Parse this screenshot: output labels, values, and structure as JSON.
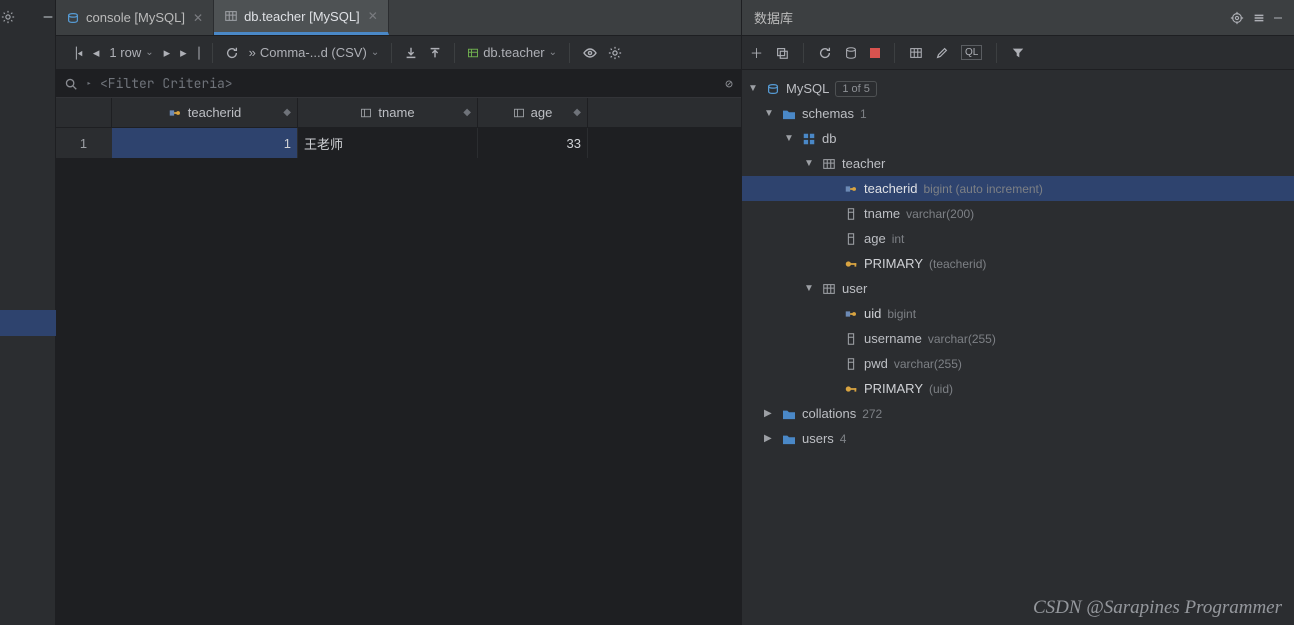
{
  "tabs": [
    {
      "label": "console [MySQL]",
      "active": false
    },
    {
      "label": "db.teacher [MySQL]",
      "active": true
    }
  ],
  "toolbar": {
    "rows_label": "1 row",
    "export_label": "Comma-...d (CSV)",
    "schema_label": "db.teacher"
  },
  "filter": {
    "placeholder": "<Filter Criteria>"
  },
  "grid": {
    "columns": [
      {
        "name": "teacherid",
        "kind": "pk"
      },
      {
        "name": "tname",
        "kind": "col"
      },
      {
        "name": "age",
        "kind": "col"
      }
    ],
    "rows": [
      {
        "num": "1",
        "teacherid": "1",
        "tname": "王老师",
        "age": "33"
      }
    ]
  },
  "right": {
    "title": "数据库",
    "tree": {
      "root": {
        "label": "MySQL",
        "badge": "1 of 5"
      },
      "schemas": {
        "label": "schemas",
        "count": "1"
      },
      "db": {
        "label": "db"
      },
      "teacher": {
        "label": "teacher",
        "columns": [
          {
            "name": "teacherid",
            "type": "bigint (auto increment)",
            "icon": "pk-col"
          },
          {
            "name": "tname",
            "type": "varchar(200)",
            "icon": "col"
          },
          {
            "name": "age",
            "type": "int",
            "icon": "col"
          }
        ],
        "pk": {
          "label": "PRIMARY",
          "cols": "(teacherid)"
        }
      },
      "user": {
        "label": "user",
        "columns": [
          {
            "name": "uid",
            "type": "bigint",
            "icon": "pk-col"
          },
          {
            "name": "username",
            "type": "varchar(255)",
            "icon": "col"
          },
          {
            "name": "pwd",
            "type": "varchar(255)",
            "icon": "col"
          }
        ],
        "pk": {
          "label": "PRIMARY",
          "cols": "(uid)"
        }
      },
      "collations": {
        "label": "collations",
        "count": "272"
      },
      "users": {
        "label": "users",
        "count": "4"
      }
    }
  },
  "watermark": "CSDN @Sarapines Programmer"
}
